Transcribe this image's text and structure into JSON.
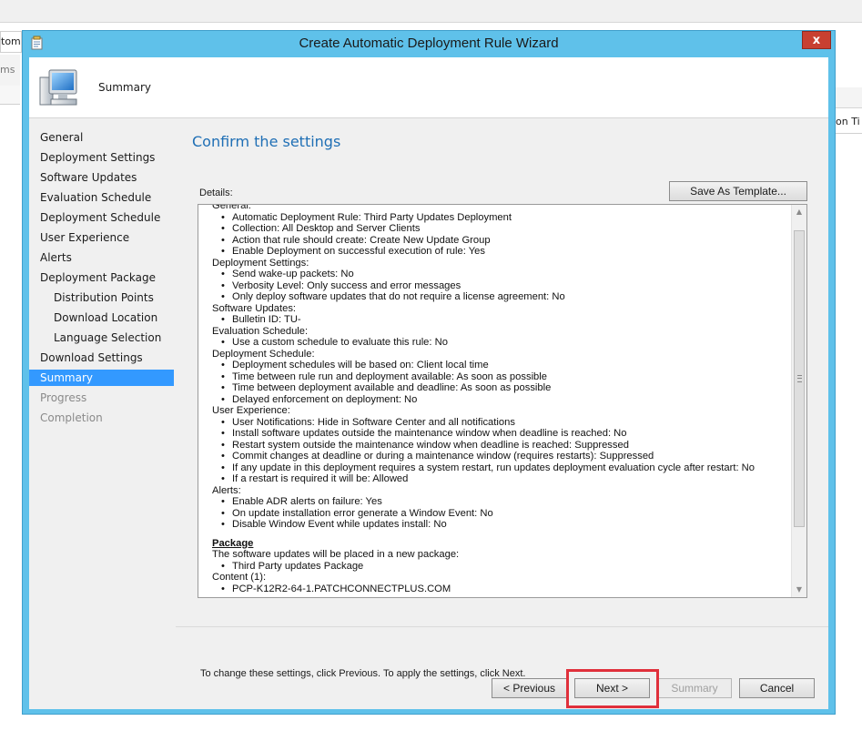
{
  "background": {
    "left_partial_1": "tom",
    "left_partial_2": "ms",
    "right_partial": "on Ti"
  },
  "window": {
    "title": "Create Automatic Deployment Rule Wizard",
    "close_label": "x"
  },
  "header": {
    "title": "Summary",
    "icon": "computer-icon"
  },
  "nav": {
    "items": [
      {
        "label": "General",
        "state": "normal",
        "sub": false
      },
      {
        "label": "Deployment Settings",
        "state": "normal",
        "sub": false
      },
      {
        "label": "Software Updates",
        "state": "normal",
        "sub": false
      },
      {
        "label": "Evaluation Schedule",
        "state": "normal",
        "sub": false
      },
      {
        "label": "Deployment Schedule",
        "state": "normal",
        "sub": false
      },
      {
        "label": "User Experience",
        "state": "normal",
        "sub": false
      },
      {
        "label": "Alerts",
        "state": "normal",
        "sub": false
      },
      {
        "label": "Deployment Package",
        "state": "normal",
        "sub": false
      },
      {
        "label": "Distribution Points",
        "state": "normal",
        "sub": true
      },
      {
        "label": "Download Location",
        "state": "normal",
        "sub": true
      },
      {
        "label": "Language Selection",
        "state": "normal",
        "sub": true
      },
      {
        "label": "Download Settings",
        "state": "normal",
        "sub": false
      },
      {
        "label": "Summary",
        "state": "active",
        "sub": false
      },
      {
        "label": "Progress",
        "state": "disabled",
        "sub": false
      },
      {
        "label": "Completion",
        "state": "disabled",
        "sub": false
      }
    ]
  },
  "main": {
    "heading": "Confirm the settings",
    "details_label": "Details:",
    "save_template_label": "Save As Template...",
    "instructions": "To change these settings, click Previous. To apply the settings, click Next.",
    "details": {
      "general": {
        "title": "General:",
        "items": [
          "Automatic Deployment Rule: Third Party Updates Deployment",
          "Collection: All Desktop and Server Clients",
          "Action that rule should create: Create New Update Group",
          "Enable Deployment on successful execution of rule: Yes"
        ]
      },
      "deployment_settings": {
        "title": "Deployment Settings:",
        "items": [
          "Send wake-up packets: No",
          "Verbosity Level: Only success and error messages",
          "Only deploy software updates that do not require a license agreement: No"
        ]
      },
      "software_updates": {
        "title": "Software Updates:",
        "items": [
          "Bulletin ID: TU-"
        ]
      },
      "evaluation_schedule": {
        "title": "Evaluation Schedule:",
        "items": [
          "Use a custom schedule to evaluate this rule: No"
        ]
      },
      "deployment_schedule": {
        "title": "Deployment Schedule:",
        "items": [
          "Deployment schedules will be based on: Client local time",
          "Time between rule run and deployment available: As soon as possible",
          "Time between deployment available and deadline: As soon as possible",
          "Delayed enforcement on deployment: No"
        ]
      },
      "user_experience": {
        "title": "User Experience:",
        "items": [
          "User Notifications: Hide in Software Center and all notifications",
          "Install software updates outside the maintenance window when deadline is reached: No",
          "Restart system outside the maintenance window when deadline is reached: Suppressed",
          "Commit changes at deadline or during a maintenance window (requires restarts): Suppressed",
          "If any update in this deployment requires a system restart, run updates deployment evaluation cycle after restart: No",
          "If a restart is required it will be: Allowed"
        ]
      },
      "alerts": {
        "title": "Alerts:",
        "items": [
          "Enable ADR alerts on failure: Yes",
          "On update installation error generate a Window Event: No",
          "Disable Window Event while updates install: No"
        ]
      },
      "package": {
        "title": "Package",
        "line": "The software updates will be placed in a new package:",
        "items": [
          "Third Party updates Package"
        ],
        "content_title": "Content (1):",
        "content_items": [
          "PCP-K12R2-64-1.PATCHCONNECTPLUS.COM"
        ]
      }
    }
  },
  "footer": {
    "previous_label": "< Previous",
    "next_label": "Next >",
    "summary_label": "Summary",
    "cancel_label": "Cancel"
  },
  "colors": {
    "frame": "#5fc1ea",
    "active_nav": "#3399ff",
    "heading": "#1f6fb5",
    "highlight": "#e0303b",
    "close": "#c84031"
  }
}
